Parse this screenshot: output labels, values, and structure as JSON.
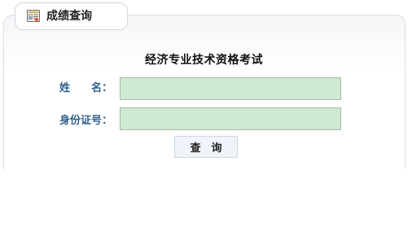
{
  "tab": {
    "title": "成绩查询",
    "icon": "certificate-icon"
  },
  "form": {
    "title": "经济专业技术资格考试",
    "name_label": "姓　　名：",
    "name_value": "",
    "id_label": "身份证号：",
    "id_value": "",
    "submit_label": "查　询"
  },
  "colors": {
    "input_background": "#cfe9d3",
    "label_text": "#2d5f8c"
  }
}
